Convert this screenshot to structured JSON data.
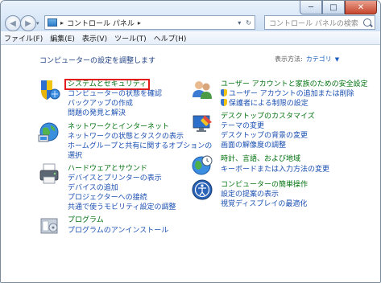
{
  "window": {
    "address": {
      "crumbs": [
        "コントロール パネル"
      ],
      "sep": "▸"
    },
    "search_placeholder": "コントロール パネルの検索",
    "controls": {
      "minimize": "─",
      "maximize": "□",
      "close": "✕"
    },
    "nav": {
      "back": "◀",
      "forward": "▶",
      "dropdown": "▾",
      "addr_dropdown": "▾",
      "refresh": "↻"
    }
  },
  "menubar": {
    "items": [
      "ファイル(F)",
      "編集(E)",
      "表示(V)",
      "ツール(T)",
      "ヘルプ(H)"
    ]
  },
  "page": {
    "heading": "コンピューターの設定を調整します",
    "view_by": {
      "label": "表示方法:",
      "value": "カテゴリ",
      "arrow": "▼"
    }
  },
  "left_categories": [
    {
      "title": "システムとセキュリティ",
      "icon": "shield-flag-icon",
      "highlighted": true,
      "links": [
        "コンピューターの状態を確認",
        "バックアップの作成",
        "問題の発見と解決"
      ]
    },
    {
      "title": "ネットワークとインターネット",
      "icon": "network-globe-icon",
      "links": [
        "ネットワークの状態とタスクの表示",
        "ホームグループと共有に関するオプションの",
        "選択"
      ]
    },
    {
      "title": "ハードウェアとサウンド",
      "icon": "printer-icon",
      "links": [
        "デバイスとプリンターの表示",
        "デバイスの追加",
        "プロジェクターへの接続",
        "共通で使うモビリティ設定の調整"
      ]
    },
    {
      "title": "プログラム",
      "icon": "programs-icon",
      "links": [
        "プログラムのアンインストール"
      ]
    }
  ],
  "right_categories": [
    {
      "title": "ユーザー アカウントと家族のための安全設定",
      "icon": "users-icon",
      "links": [
        "ユーザー アカウントの追加または削除",
        "保護者による制限の設定"
      ],
      "shield_links": [
        0,
        1
      ]
    },
    {
      "title": "デスクトップのカスタマイズ",
      "icon": "desktop-paint-icon",
      "links": [
        "テーマの変更",
        "デスクトップの背景の変更",
        "画面の解像度の調整"
      ]
    },
    {
      "title": "時計、言語、および地域",
      "icon": "clock-globe-icon",
      "links": [
        "キーボードまたは入力方法の変更"
      ]
    },
    {
      "title": "コンピューターの簡単操作",
      "icon": "ease-of-access-icon",
      "links": [
        "設定の提案の表示",
        "視覚ディスプレイの最適化"
      ]
    }
  ]
}
